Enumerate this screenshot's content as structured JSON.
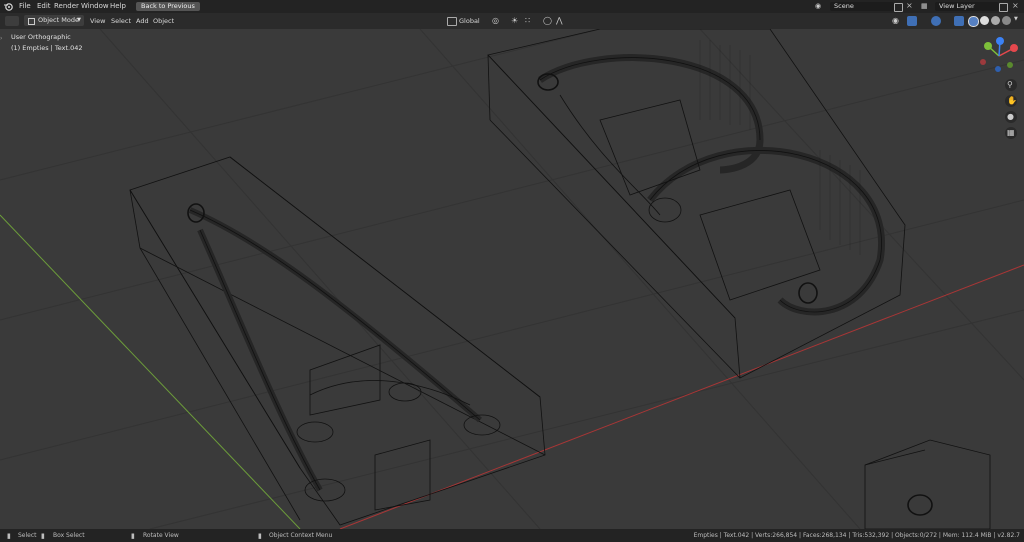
{
  "topbar": {
    "menus": [
      "File",
      "Edit",
      "Render",
      "Window",
      "Help"
    ],
    "back_button": "Back to Previous",
    "scene_label": "Scene",
    "view_layer_label": "View Layer"
  },
  "header": {
    "mode": "Object Mode",
    "menus": [
      "View",
      "Select",
      "Add",
      "Object"
    ],
    "orientation": "Global"
  },
  "viewport": {
    "view_name": "User Orthographic",
    "object_info": "(1) Empties | Text.042"
  },
  "gizmo": {
    "x_color": "#e5484d",
    "y_color": "#7dbf3a",
    "z_color": "#3b82f6"
  },
  "statusbar": {
    "select": "Select",
    "box_select": "Box Select",
    "rotate_view": "Rotate View",
    "context_menu": "Object Context Menu",
    "stats": "Empties | Text.042 | Verts:266,854 | Faces:268,134 | Tris:532,392 | Objects:0/272 | Mem: 112.4 MiB | v2.82.7"
  }
}
